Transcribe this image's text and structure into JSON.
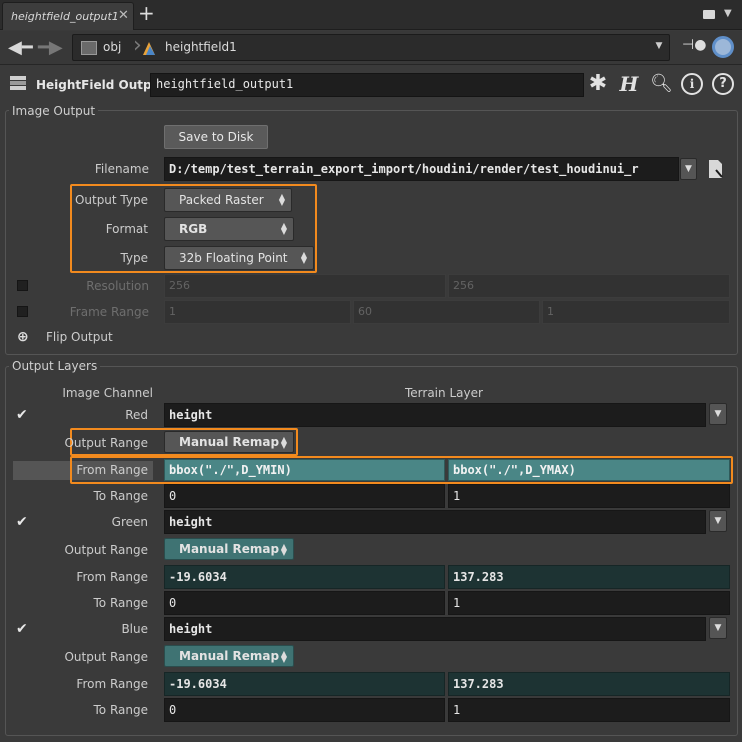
{
  "tab": {
    "title": "heightfield_output1",
    "close": "✕",
    "add": "+"
  },
  "path": {
    "root": "obj",
    "node": "heightfield1"
  },
  "header": {
    "type_label": "HeightField Output",
    "node_name": "heightfield_output1"
  },
  "image_output": {
    "title": "Image Output",
    "save_button": "Save to Disk",
    "filename_label": "Filename",
    "filename_value": "D:/temp/test_terrain_export_import/houdini/render/test_houdinui_r",
    "output_type_label": "Output Type",
    "output_type_value": "Packed Raster",
    "format_label": "Format",
    "format_value": "RGB",
    "type_label": "Type",
    "type_value": "32b Floating Point",
    "resolution_label": "Resolution",
    "resolution_values": [
      "256",
      "256"
    ],
    "frame_range_label": "Frame Range",
    "frame_range_values": [
      "1",
      "60",
      "1"
    ],
    "flip_label": "Flip Output"
  },
  "output_layers": {
    "title": "Output Layers",
    "col_image_channel": "Image Channel",
    "col_terrain_layer": "Terrain Layer",
    "red": {
      "label": "Red",
      "layer": "height",
      "output_range_label": "Output Range",
      "output_range": "Manual Remap",
      "from_label": "From Range",
      "from_min": "bbox(\"./\",D_YMIN)",
      "from_max": "bbox(\"./\",D_YMAX)",
      "to_label": "To Range",
      "to_min": "0",
      "to_max": "1"
    },
    "green": {
      "label": "Green",
      "layer": "height",
      "output_range_label": "Output Range",
      "output_range": "Manual Remap",
      "from_label": "From Range",
      "from_min": "-19.6034",
      "from_max": "137.283",
      "to_label": "To Range",
      "to_min": "0",
      "to_max": "1"
    },
    "blue": {
      "label": "Blue",
      "layer": "height",
      "output_range_label": "Output Range",
      "output_range": "Manual Remap",
      "from_label": "From Range",
      "from_min": "-19.6034",
      "from_max": "137.283",
      "to_label": "To Range",
      "to_min": "0",
      "to_max": "1"
    }
  },
  "colors": {
    "highlight": "#f28a1e",
    "teal": "#3f7373",
    "teal_bright": "#4a8686",
    "panel": "#3a3a3a"
  }
}
